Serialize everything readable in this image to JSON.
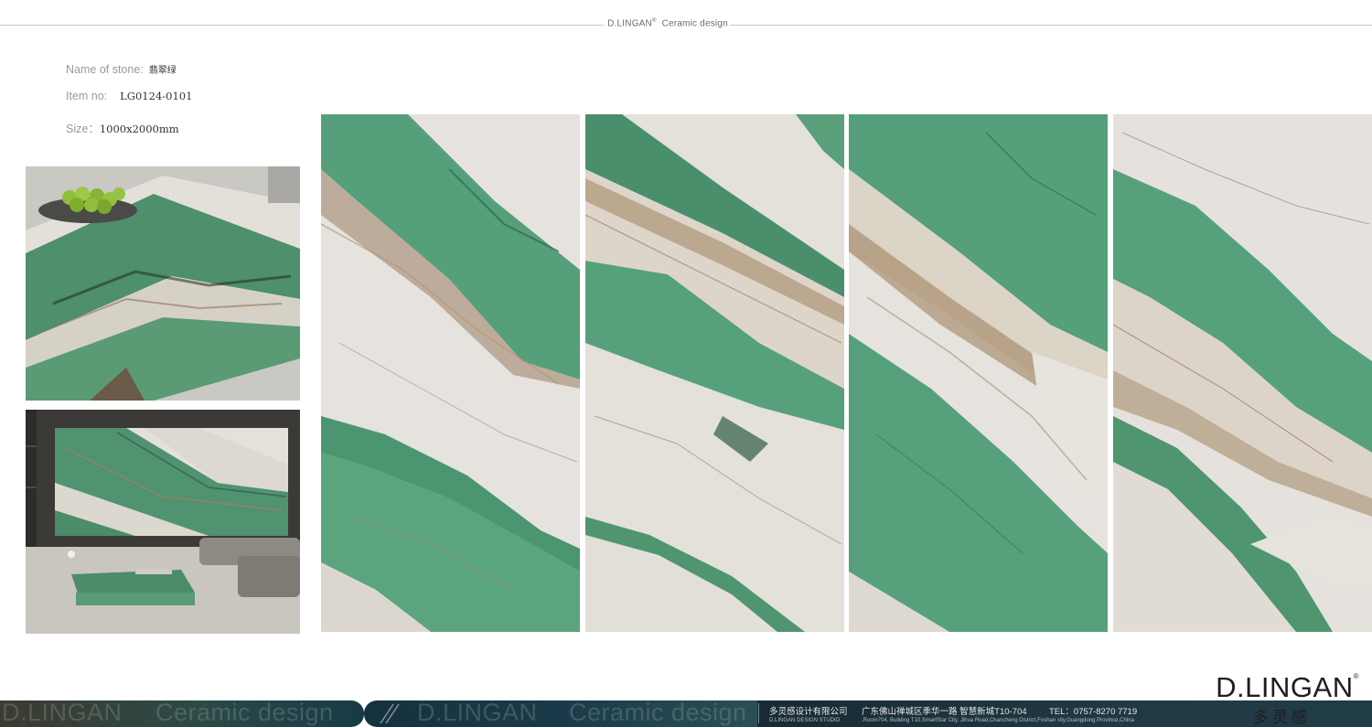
{
  "header": {
    "brand": "D.LINGAN",
    "brand_mark": "®",
    "tagline": "Ceramic design"
  },
  "specs": {
    "name_label": "Name  of stone:",
    "name_value": "翡翠绿",
    "item_label": "Item no:",
    "item_value": "LG0124-0101",
    "size_label": "Size：",
    "size_value": "1000x2000mm"
  },
  "logo": {
    "text": "D.LINGAN",
    "mark": "®",
    "chinese": "多灵感"
  },
  "footer": {
    "ghost_brand": "D.LINGAN",
    "ghost_tagline": "Ceramic design",
    "company_cn": "多灵感设计有限公司",
    "studio_en": "D.LINGAN DESIGN STUDIO",
    "address_cn": "广东佛山禅城区季华一路  智慧新城T10-704",
    "tel": "TEL：0757-8270 7719",
    "address_en": ".Room704, Building T10,SmartStar City, Jihua Road,Chancheng  District,Foshan  city,Guangdong Province,China"
  },
  "colors": {
    "green_vein": "#4f9873",
    "white_marble": "#e7e4df",
    "brown_vein": "#a58a6c",
    "footer_dark": "#1c3540"
  }
}
